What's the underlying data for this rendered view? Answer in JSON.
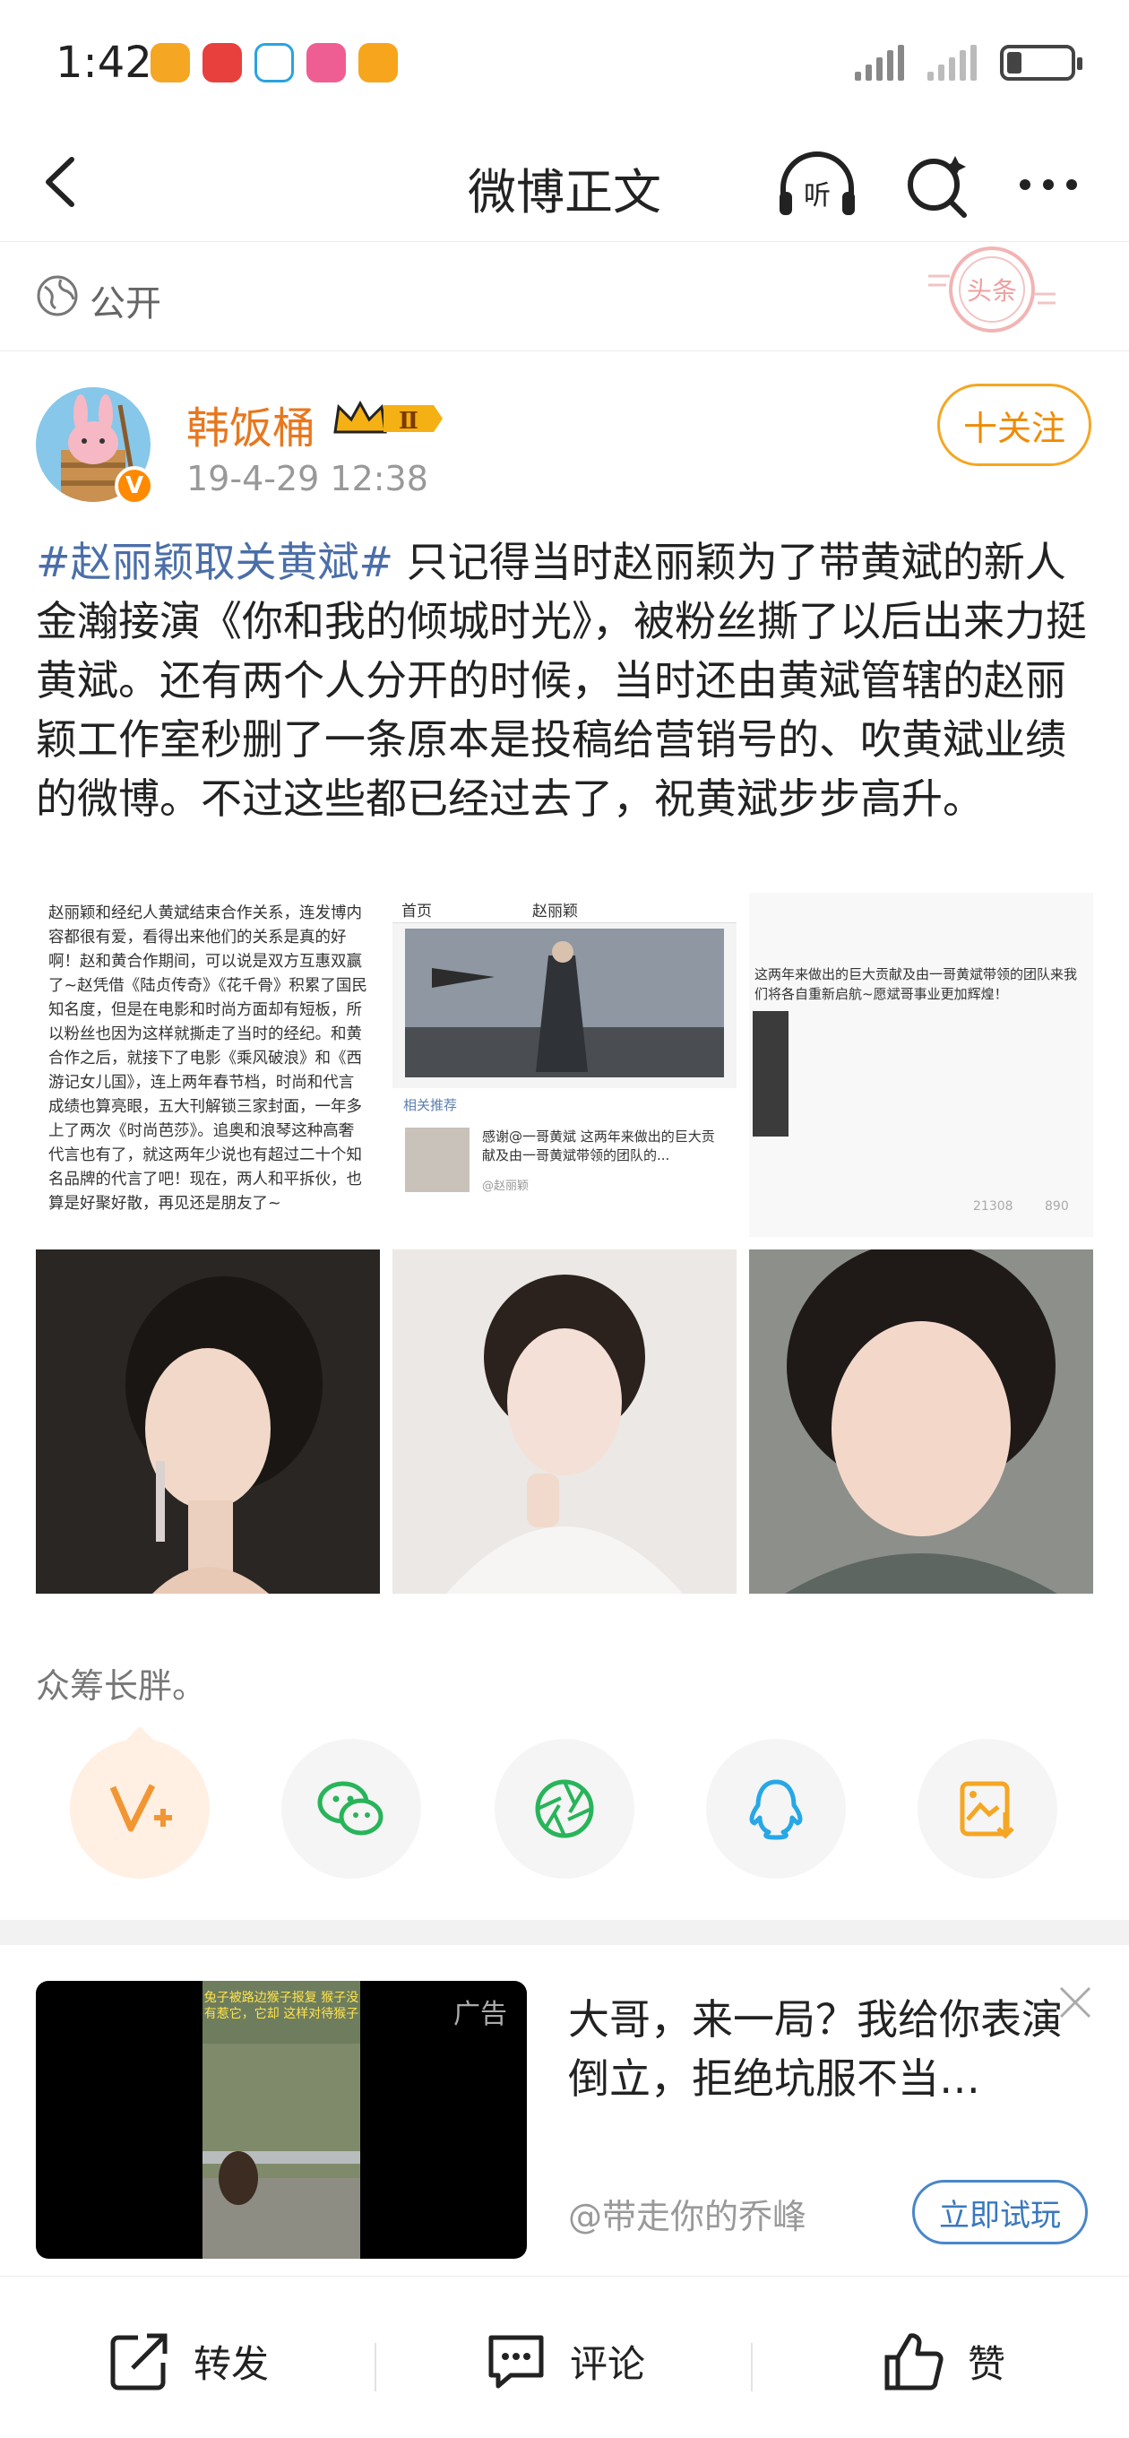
{
  "status_bar": {
    "time": "1:42"
  },
  "nav": {
    "title": "微博正文"
  },
  "visibility": {
    "label": "公开",
    "stamp_text": "头条"
  },
  "author": {
    "name": "韩饭桶",
    "badge": "Ⅱ",
    "time": "19-4-29 12:38",
    "follow_label": "十关注"
  },
  "post": {
    "hashtag": "#赵丽颖取关黄斌#",
    "text": " 只记得当时赵丽颖为了带黄斌的新人金瀚接演《你和我的倾城时光》，被粉丝撕了以后出来力挺黄斌。还有两个人分开的时候，当时还由黄斌管辖的赵丽颖工作室秒删了一条原本是投稿给营销号的、吹黄斌业绩的微博。不过这些都已经过去了，祝黄斌步步高升。"
  },
  "images": {
    "img1_text": "赵丽颖和经纪人黄斌结束合作关系，连发博内容都很有爱，看得出来他们的关系是真的好啊！赵和黄合作期间，可以说是双方互惠双赢了~赵凭借《陆贞传奇》《花千骨》积累了国民知名度，但是在电影和时尚方面却有短板，所以粉丝也因为这样就撕走了当时的经纪。和黄合作之后，就接下了电影《乘风破浪》和《西游记女儿国》，连上两年春节档，时尚和代言成绩也算亮眼，五大刊解锁三家封面，一年多上了两次《时尚芭莎》。追奥和浪琴这种高奢代言也有了，就这两年少说也有超过二十个知名品牌的代言了吧！现在，两人和平拆伙，也算是好聚好散，再见还是朋友了~",
    "img2_back": "首页",
    "img2_user": "赵丽颖",
    "img2_related": "相关推荐",
    "img2_caption": "感谢@一哥黄斌 这两年来做出的巨大贡献及由一哥黄斌带领的团队的...",
    "img2_source": "@赵丽颖",
    "img3_text": "这两年来做出的巨大贡献及由一哥黄斌带领的团队来我们将各自重新启航~愿斌哥事业更加辉煌！",
    "img3_stat1": "21308",
    "img3_stat2": "890"
  },
  "like_line": "众筹长胖。",
  "ad": {
    "tag": "广告",
    "thumb_caption": "兔子被路边猴子报复 猴子没有惹它，它却 这样对待猴子",
    "title": "大哥，来一局？我给你表演倒立，拒绝坑服不当…",
    "account": "@带走你的乔峰",
    "cta": "立即试玩"
  },
  "bottom": {
    "repost": "转发",
    "comment": "评论",
    "like": "赞"
  },
  "colors": {
    "accent_orange": "#f08a00",
    "link_blue": "#4a6ea8",
    "cta_blue": "#3a78bd"
  }
}
